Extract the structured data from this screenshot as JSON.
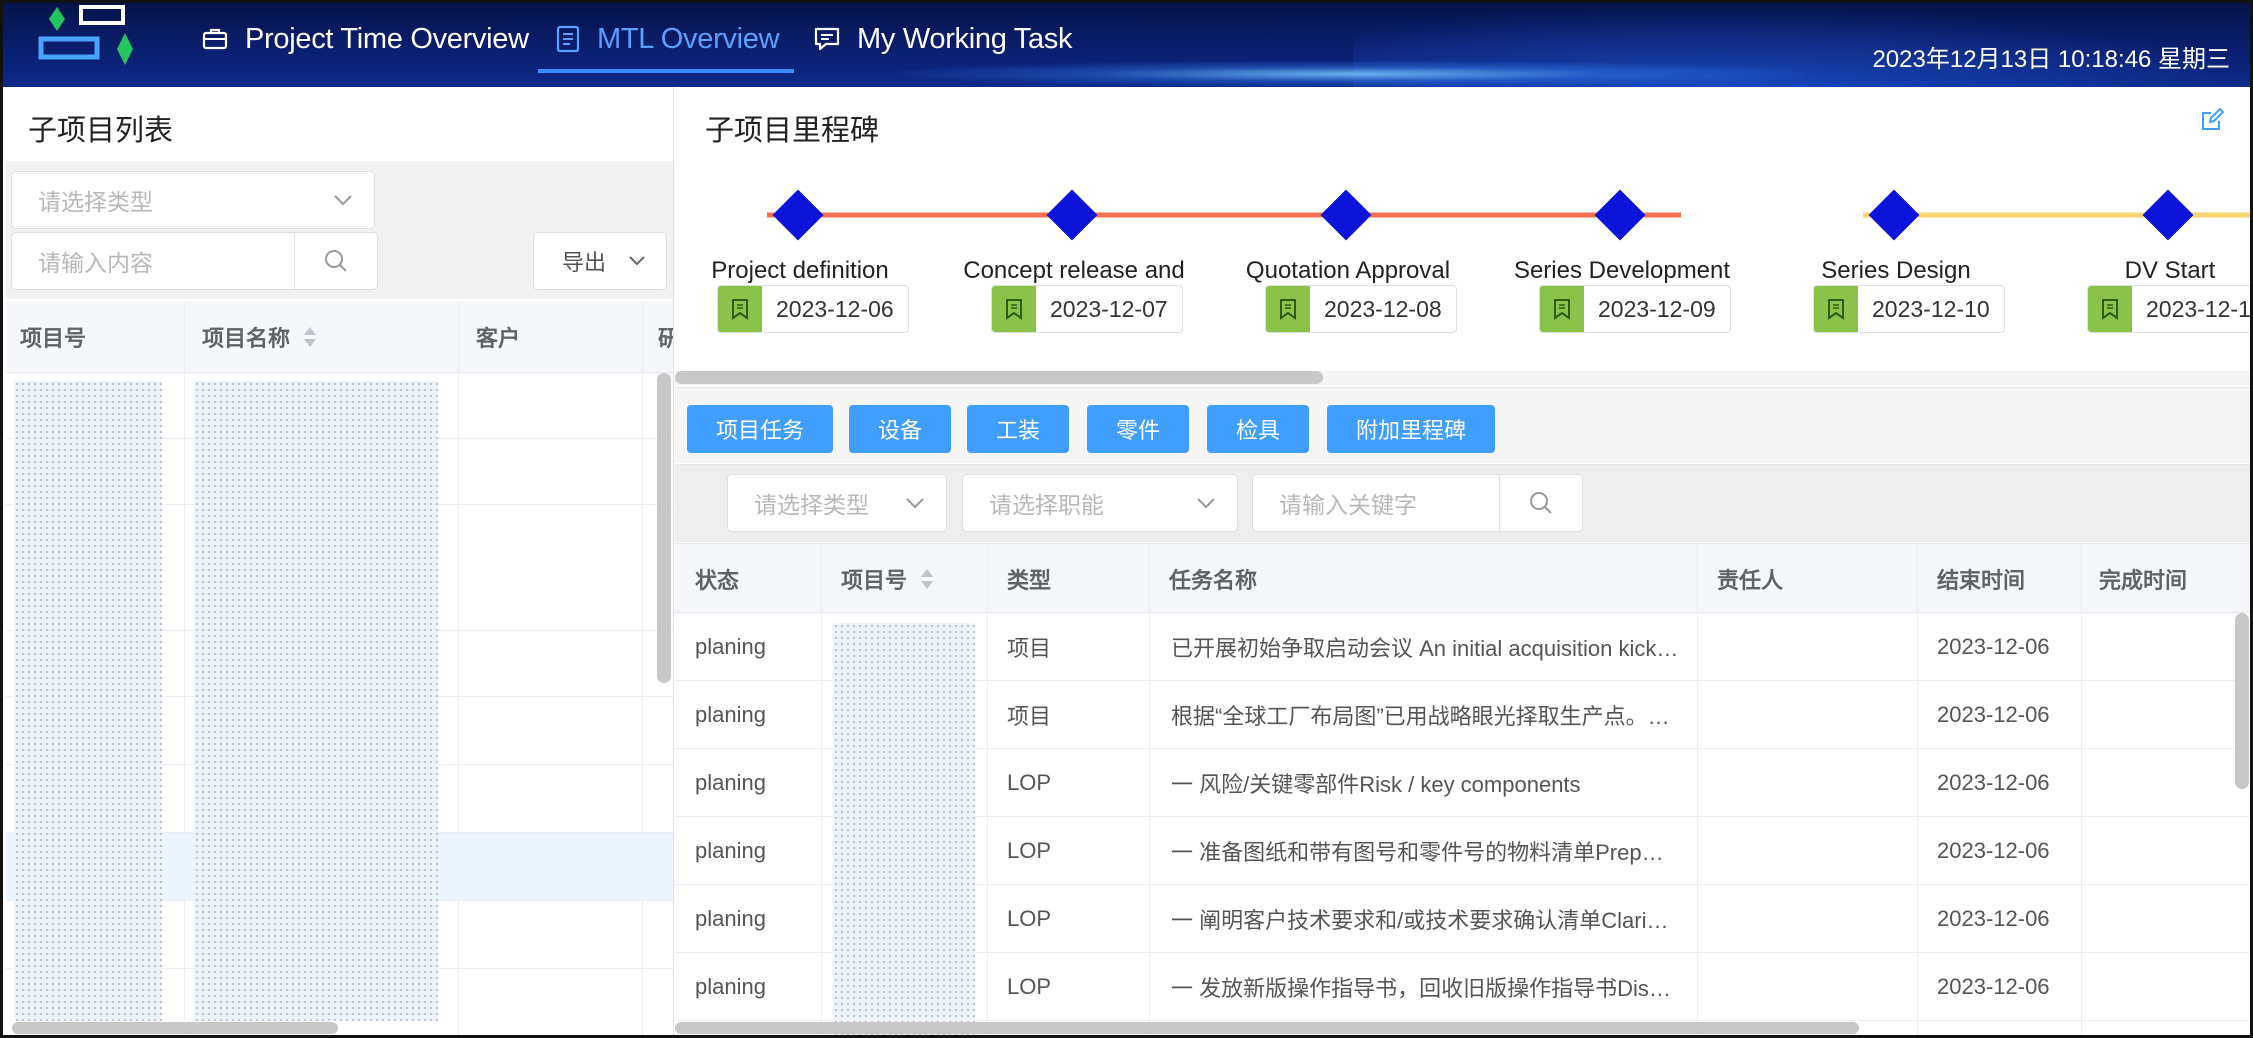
{
  "header": {
    "nav": [
      {
        "label": "Project Time Overview",
        "icon": "briefcase-icon"
      },
      {
        "label": "MTL Overview",
        "icon": "document-icon",
        "active": true
      },
      {
        "label": "My Working Task",
        "icon": "message-icon"
      }
    ],
    "clock": "2023年12月13日  10:18:46  星期三"
  },
  "left_panel": {
    "title": "子项目列表",
    "type_placeholder": "请选择类型",
    "search_placeholder": "请输入内容",
    "export_label": "导出",
    "columns": [
      "项目号",
      "项目名称",
      "客户",
      "研"
    ]
  },
  "right_panel": {
    "title": "子项目里程碑",
    "milestones": [
      {
        "label": "Project definition",
        "date": "2023-12-06"
      },
      {
        "label": "Concept release and",
        "date": "2023-12-07"
      },
      {
        "label": "Quotation Approval",
        "date": "2023-12-08"
      },
      {
        "label": "Series Development",
        "date": "2023-12-09"
      },
      {
        "label": "Series Design",
        "date": "2023-12-10"
      },
      {
        "label": "DV Start",
        "date": "2023-12-1"
      }
    ],
    "tabs": [
      "项目任务",
      "设备",
      "工装",
      "零件",
      "检具",
      "附加里程碑"
    ],
    "filters": {
      "type_placeholder": "请选择类型",
      "function_placeholder": "请选择职能",
      "keyword_placeholder": "请输入关键字"
    },
    "columns": [
      "状态",
      "项目号",
      "类型",
      "任务名称",
      "责任人",
      "结束时间",
      "完成时间"
    ],
    "rows": [
      {
        "status": "planing",
        "type": "项目",
        "task": "已开展初始争取启动会议 An initial acquisition kick…",
        "end": "2023-12-06"
      },
      {
        "status": "planing",
        "type": "项目",
        "task": "根据“全球工厂布局图”已用战略眼光择取生产点。…",
        "end": "2023-12-06"
      },
      {
        "status": "planing",
        "type": "LOP",
        "task": "一  风险/关键零部件Risk / key components",
        "end": "2023-12-06"
      },
      {
        "status": "planing",
        "type": "LOP",
        "task": "一  准备图纸和带有图号和零件号的物料清单Prep…",
        "end": "2023-12-06"
      },
      {
        "status": "planing",
        "type": "LOP",
        "task": "一  阐明客户技术要求和/或技术要求确认清单Clari…",
        "end": "2023-12-06"
      },
      {
        "status": "planing",
        "type": "LOP",
        "task": "一  发放新版操作指导书，回收旧版操作指导书Dis…",
        "end": "2023-12-06"
      }
    ]
  },
  "colors": {
    "header_bg": "#0a1f6e",
    "accent": "#409eff",
    "milestone_diamond": "#0a14d8",
    "timeline_done": "#f07050",
    "timeline_pending": "#f5d76e",
    "flag_green": "#8bc34a"
  }
}
